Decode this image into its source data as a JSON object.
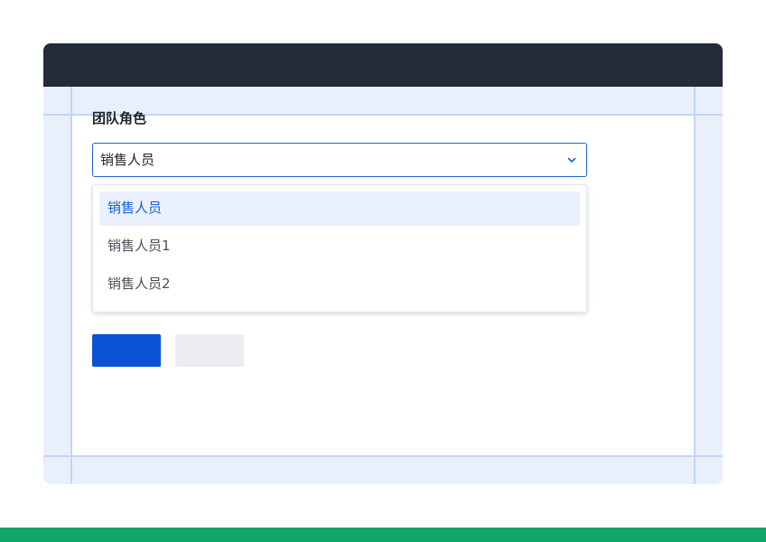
{
  "form": {
    "label": "团队角色",
    "select": {
      "value": "销售人员",
      "icon": "chevron-down-icon"
    },
    "options": [
      {
        "label": "销售人员",
        "selected": true
      },
      {
        "label": "销售人员1",
        "selected": false
      },
      {
        "label": "销售人员2",
        "selected": false
      }
    ],
    "primary_button_label": "",
    "secondary_button_label": ""
  },
  "colors": {
    "titlebar": "#252b38",
    "accent": "#1e62d8",
    "primary_button": "#0b53d6",
    "secondary_button": "#ebecef",
    "selected_option_bg": "#eaf1fc",
    "footer": "#10a56a"
  }
}
